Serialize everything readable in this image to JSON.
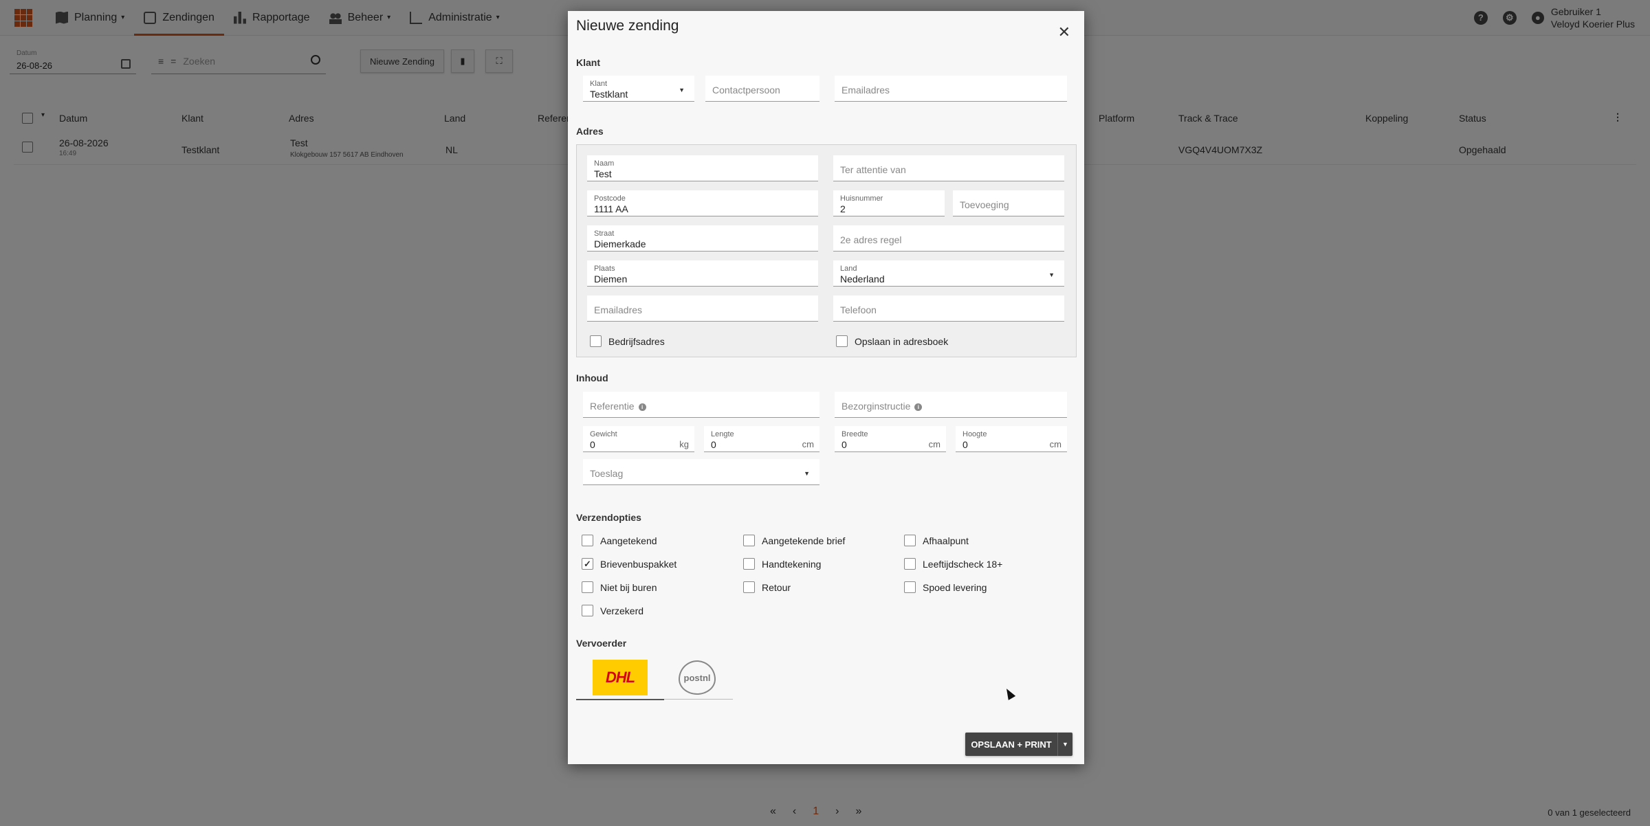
{
  "nav": {
    "items": [
      {
        "label": "Planning",
        "dropdown": true
      },
      {
        "label": "Zendingen",
        "dropdown": false
      },
      {
        "label": "Rapportage",
        "dropdown": false
      },
      {
        "label": "Beheer",
        "dropdown": true
      },
      {
        "label": "Administratie",
        "dropdown": true
      }
    ],
    "user_name": "Gebruiker 1",
    "company": "Veloyd Koerier Plus"
  },
  "toolbar": {
    "date_label": "Datum",
    "date_value": "26-08-26",
    "search_placeholder": "Zoeken",
    "new_shipment": "Nieuwe Zending"
  },
  "table": {
    "headers": [
      "Datum",
      "Klant",
      "Adres",
      "Land",
      "Referen",
      "Platform",
      "Track & Trace",
      "Koppeling",
      "Status"
    ],
    "row": {
      "date": "26-08-2026",
      "time": "16:49",
      "client": "Testklant",
      "addr_name": "Test",
      "addr_line": "Klokgebouw 157 5617 AB Eindhoven",
      "country": "NL",
      "track": "VGQ4V4UOM7X3Z",
      "status": "Opgehaald"
    }
  },
  "pager": {
    "current": "1",
    "selected": "0 van 1 geselecteerd"
  },
  "modal": {
    "title": "Nieuwe zending",
    "sections": {
      "klant": "Klant",
      "adres": "Adres",
      "inhoud": "Inhoud",
      "verzendopties": "Verzendopties",
      "vervoerder": "Vervoerder"
    },
    "klant": {
      "label": "Klant",
      "value": "Testklant",
      "contact_placeholder": "Contactpersoon",
      "email_placeholder": "Emailadres"
    },
    "adres": {
      "naam_label": "Naam",
      "naam": "Test",
      "attn_placeholder": "Ter attentie van",
      "postcode_label": "Postcode",
      "postcode": "1111 AA",
      "huisnr_label": "Huisnummer",
      "huisnr": "2",
      "toevoeging_placeholder": "Toevoeging",
      "straat_label": "Straat",
      "straat": "Diemerkade",
      "regel2_placeholder": "2e adres regel",
      "plaats_label": "Plaats",
      "plaats": "Diemen",
      "land_label": "Land",
      "land": "Nederland",
      "email_placeholder": "Emailadres",
      "telefoon_placeholder": "Telefoon",
      "bedrijf": "Bedrijfsadres",
      "opslaan": "Opslaan in adresboek"
    },
    "inhoud": {
      "referentie_placeholder": "Referentie",
      "bezorg_placeholder": "Bezorginstructie",
      "gewicht_label": "Gewicht",
      "gewicht": "0",
      "gewicht_unit": "kg",
      "lengte_label": "Lengte",
      "lengte": "0",
      "lengte_unit": "cm",
      "breedte_label": "Breedte",
      "breedte": "0",
      "breedte_unit": "cm",
      "hoogte_label": "Hoogte",
      "hoogte": "0",
      "hoogte_unit": "cm",
      "toeslag_placeholder": "Toeslag"
    },
    "opties": [
      {
        "label": "Aangetekend",
        "checked": false
      },
      {
        "label": "Aangetekende brief",
        "checked": false
      },
      {
        "label": "Afhaalpunt",
        "checked": false
      },
      {
        "label": "Brievenbuspakket",
        "checked": true
      },
      {
        "label": "Handtekening",
        "checked": false
      },
      {
        "label": "Leeftijdscheck 18+",
        "checked": false
      },
      {
        "label": "Niet bij buren",
        "checked": false
      },
      {
        "label": "Retour",
        "checked": false
      },
      {
        "label": "Spoed levering",
        "checked": false
      },
      {
        "label": "Verzekerd",
        "checked": false
      }
    ],
    "carriers": {
      "dhl": "DHL",
      "postnl": "postnl"
    },
    "save_label": "OPSLAAN + PRINT"
  },
  "colors": {
    "accent": "#d4541c",
    "dhl_yellow": "#ffcc00",
    "dhl_red": "#d40511"
  }
}
